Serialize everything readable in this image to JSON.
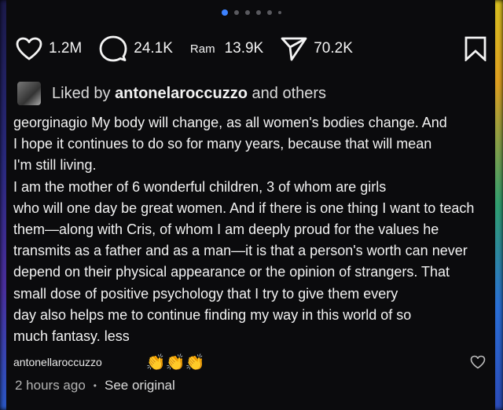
{
  "pagination": {
    "total": 6,
    "active": 0
  },
  "actions": {
    "likes": "1.2M",
    "comments": "24.1K",
    "ram_label": "Ram",
    "reposts": "13.9K",
    "shares": "70.2K"
  },
  "liked_by": {
    "prefix": "Liked by",
    "user": "antonelaroccuzzo",
    "suffix": "and others"
  },
  "caption": {
    "lines": [
      "georginagio My body will change, as all women's bodies change. And",
      "I hope it continues to do so for many years, because that will mean",
      "I'm still living.",
      "I am the mother of 6 wonderful children, 3 of whom are girls",
      "who will one day be great women. And if there is one thing I want to teach",
      "them—along with Cris, of whom I am deeply proud for the values he",
      "transmits as a father and as a man—it is that a person's worth can never",
      "depend on their physical appearance or the opinion of strangers. That",
      "small dose of positive psychology that I try to give them every",
      "day also helps me to continue finding my way in this world of so",
      "much fantasy. less"
    ]
  },
  "comment": {
    "user": "antonellaroccuzzo",
    "text": "👏👏👏"
  },
  "meta": {
    "time": "2 hours ago",
    "separator": "•",
    "see_original": "See original"
  },
  "colors": {
    "accent": "#3d82ff",
    "background": "#0b0b0d"
  }
}
